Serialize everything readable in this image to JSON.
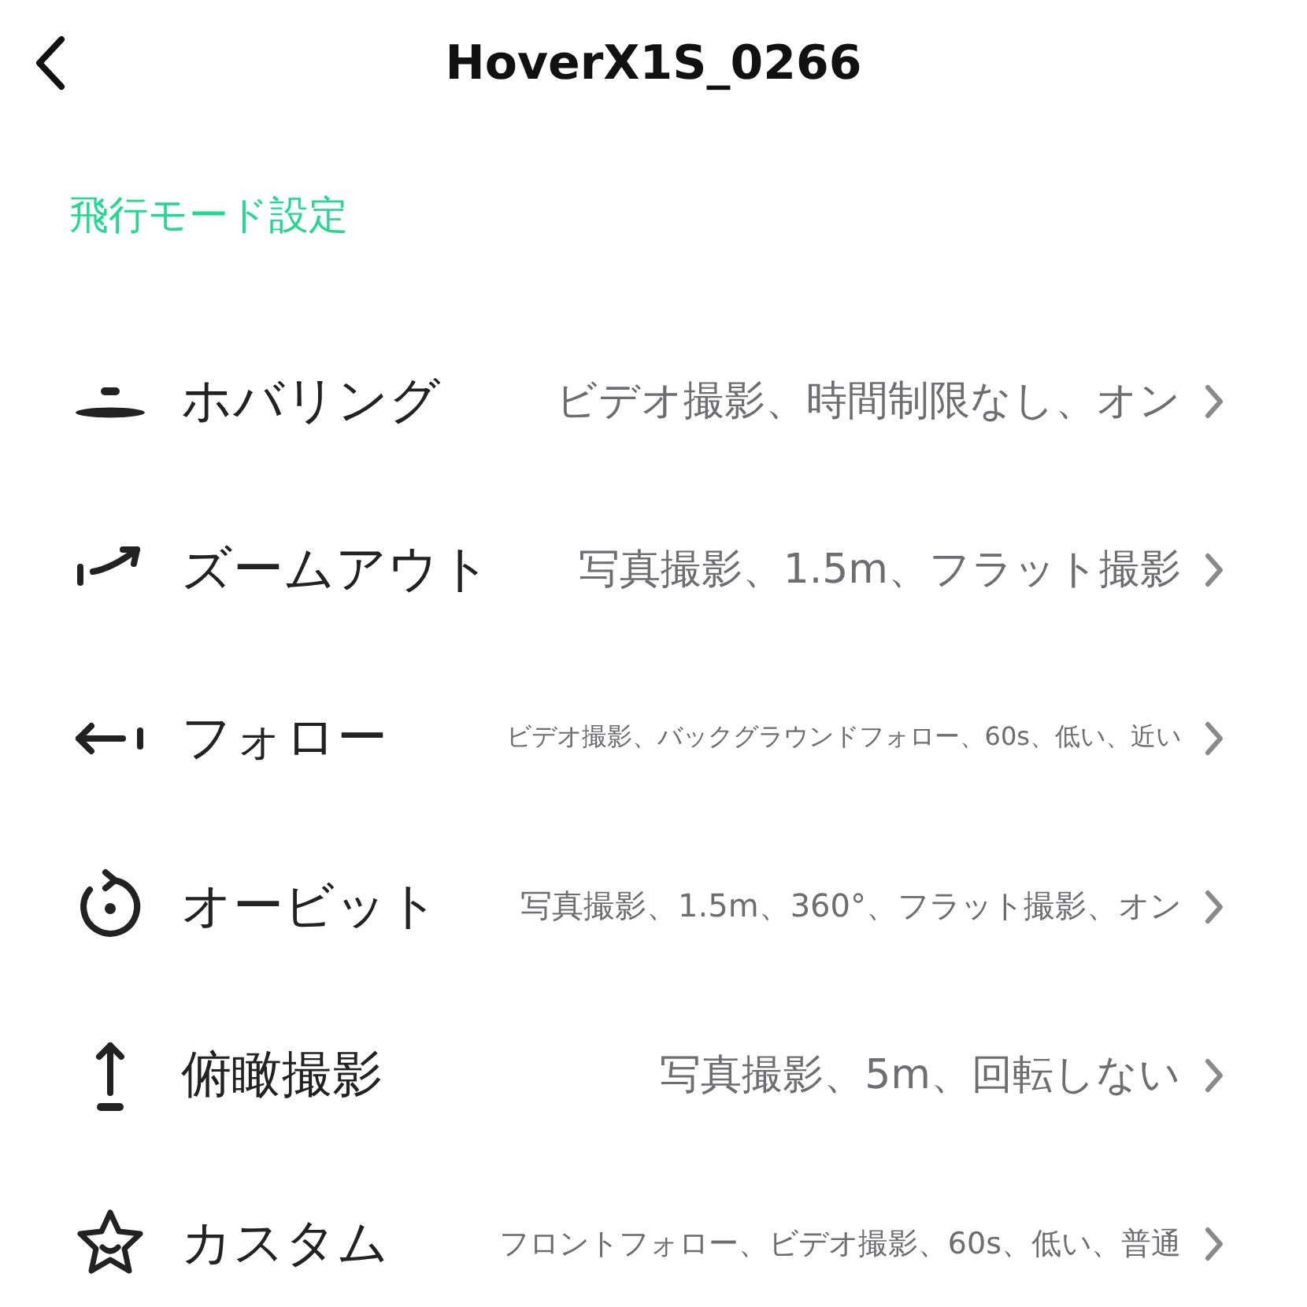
{
  "header": {
    "title": "HoverX1S_0266"
  },
  "section": {
    "title": "飛行モード設定"
  },
  "modes": [
    {
      "kind": "hover",
      "name": "ホバリング",
      "value": "ビデオ撮影、時間制限なし、オン"
    },
    {
      "kind": "zoomout",
      "name": "ズームアウト",
      "value": "写真撮影、1.5m、フラット撮影"
    },
    {
      "kind": "follow",
      "name": "フォロー",
      "value": "ビデオ撮影、バックグラウンドフォロー、60s、低い、近い"
    },
    {
      "kind": "orbit",
      "name": "オービット",
      "value": "写真撮影、1.5m、360°、フラット撮影、オン"
    },
    {
      "kind": "overhead",
      "name": "俯瞰撮影",
      "value": "写真撮影、5m、回転しない"
    },
    {
      "kind": "custom",
      "name": "カスタム",
      "value": "フロントフォロー、ビデオ撮影、60s、低い、普通"
    }
  ]
}
